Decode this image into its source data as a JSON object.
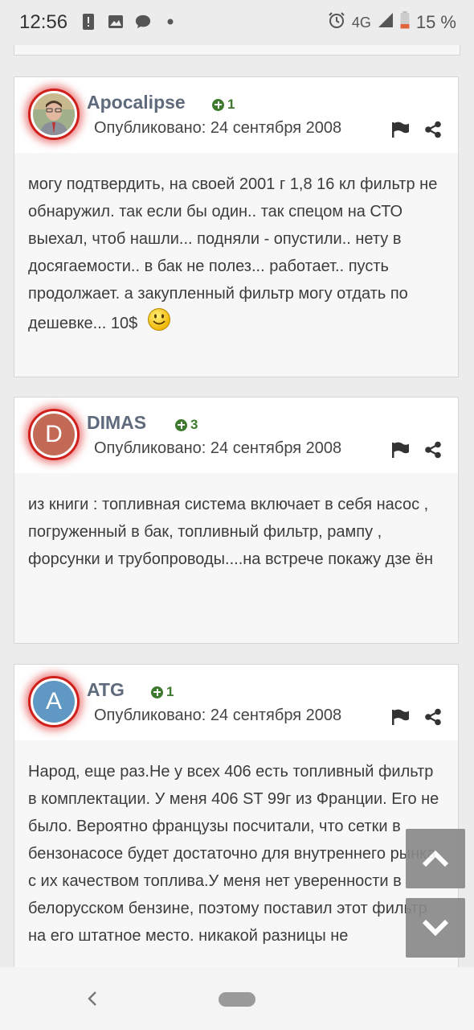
{
  "status_bar": {
    "time": "12:56",
    "network": "4G",
    "battery": "15 %",
    "icons": [
      "alert-icon",
      "image-icon",
      "chat-icon",
      "dot-icon",
      "alarm-icon",
      "signal-icon",
      "battery-icon"
    ]
  },
  "posts": [
    {
      "author": "Apocalipse",
      "avatar_letter": "",
      "avatar_color": "#7a8a6a",
      "reputation": "1",
      "published": "Опубликовано: 24 сентября 2008",
      "body": "могу подтвердить, на своей 2001 г 1,8 16 кл фильтр не обнаружил. так если бы один.. так спецом на СТО выехал, чтоб нашли... подняли - опустили.. нету в досягаемости.. в бак не полез... работает.. пусть продолжает. а закупленный фильтр могу отдать по дешевке... 10$"
    },
    {
      "author": "DIMAS",
      "avatar_letter": "D",
      "avatar_color": "#c26a55",
      "reputation": "3",
      "published": "Опубликовано: 24 сентября 2008",
      "body": "из книги : топливная система включает в себя насос , погруженный в бак, топливный фильтр, рампу , форсунки и трубопроводы....на встрече покажу дзе ён"
    },
    {
      "author": "ATG",
      "avatar_letter": "A",
      "avatar_color": "#5f98c2",
      "reputation": "1",
      "published": "Опубликовано: 24 сентября 2008",
      "body": "Народ, еще раз.Не у всех 406 есть топливный фильтр в комплектации. У меня 406 ST 99г из Франции. Его не было. Вероятно французы посчитали, что сетки в бензонасосе будет достаточно для внутреннего рынка с их качеством топлива.У меня нет уверенности в белорусском бензине, поэтому поставил этот фильтр на его штатное место. никакой разницы не"
    }
  ],
  "colors": {
    "accent_ring": "#d0201c",
    "author": "#5f6b7c",
    "reputation": "#3e7a2e"
  }
}
